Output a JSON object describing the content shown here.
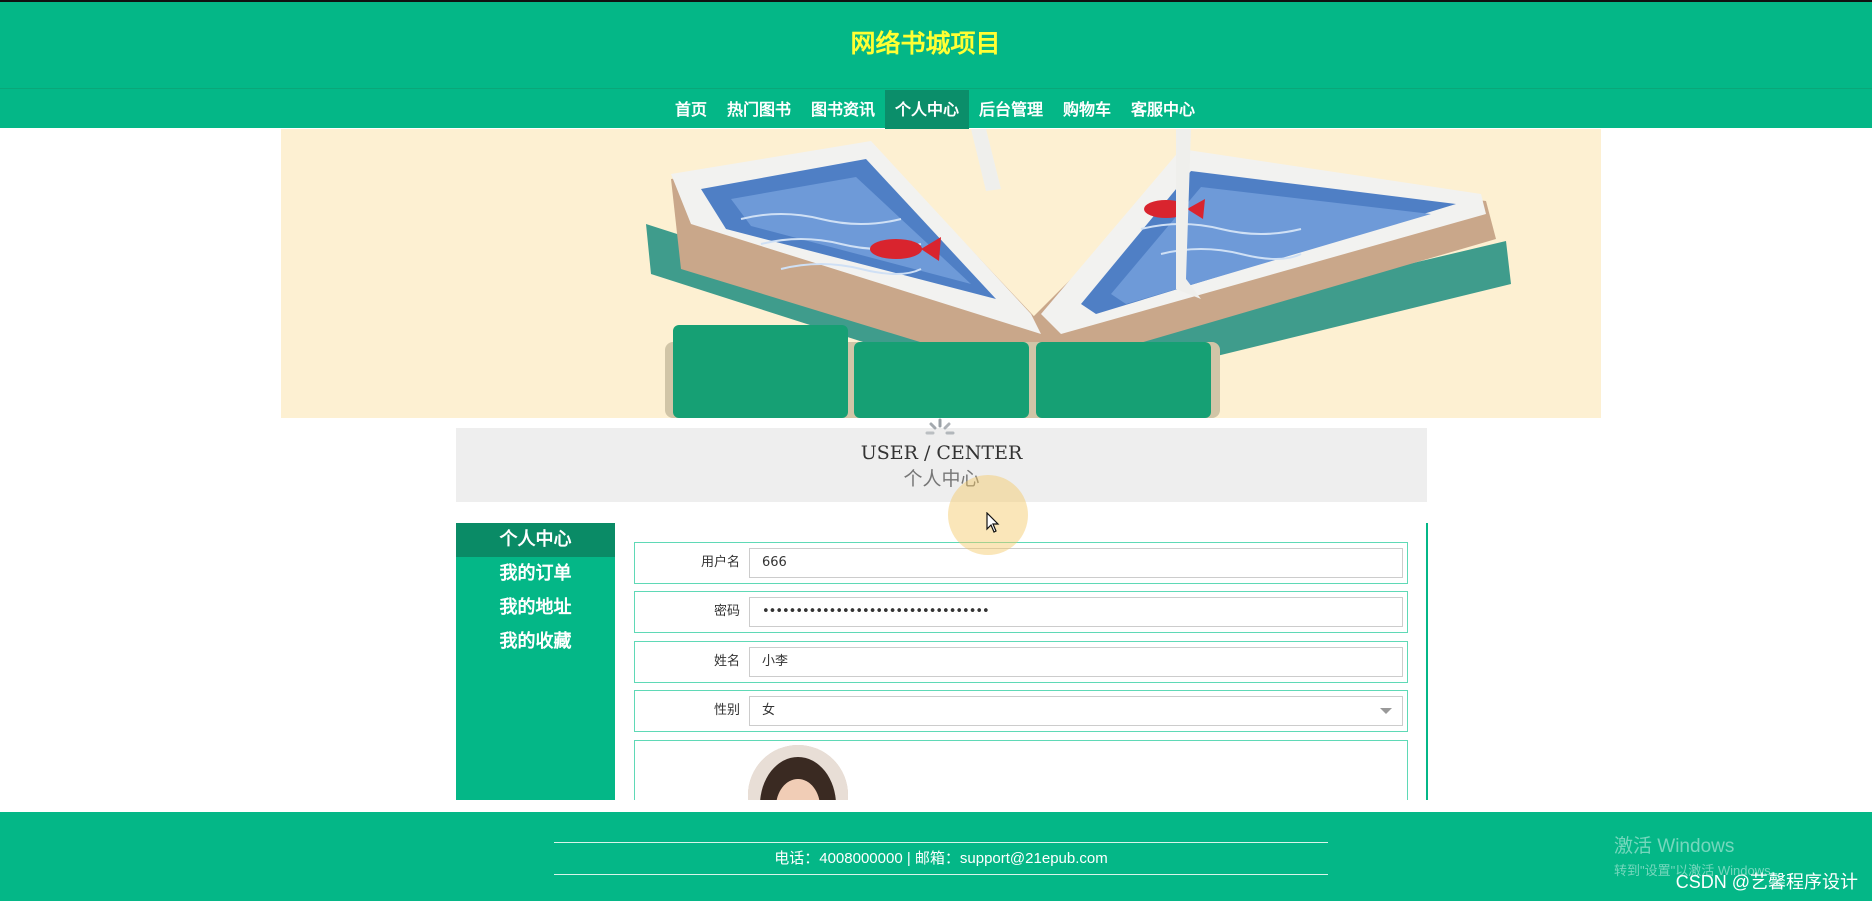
{
  "header": {
    "site_title": "网络书城项目",
    "nav": [
      {
        "label": "首页"
      },
      {
        "label": "热门图书"
      },
      {
        "label": "图书资讯"
      },
      {
        "label": "个人中心",
        "active": true
      },
      {
        "label": "后台管理"
      },
      {
        "label": "购物车"
      },
      {
        "label": "客服中心"
      }
    ]
  },
  "banner": {
    "image": "open-book-with-fish-pond-illustration"
  },
  "section": {
    "title_en": "USER / CENTER",
    "title_cn": "个人中心"
  },
  "sidebar": {
    "items": [
      {
        "label": "个人中心",
        "active": true
      },
      {
        "label": "我的订单"
      },
      {
        "label": "我的地址"
      },
      {
        "label": "我的收藏"
      }
    ]
  },
  "form": {
    "username": {
      "label": "用户名",
      "value": "666"
    },
    "password": {
      "label": "密码",
      "value": "••••••••••••••••••••••••••••••••••"
    },
    "name": {
      "label": "姓名",
      "value": "小李"
    },
    "gender": {
      "label": "性别",
      "value": "女"
    }
  },
  "footer": {
    "contact": "电话：4008000000 | 邮箱：support@21epub.com"
  },
  "overlay": {
    "activation_title": "激活 Windows",
    "activation_sub": "转到\"设置\"以激活 Windows。",
    "csdn": "CSDN @艺馨程序设计"
  },
  "colors": {
    "primary": "#04b787",
    "title": "#ffff33",
    "active_nav": "#0b8e6a",
    "banner_bg": "#fdf0d2"
  }
}
